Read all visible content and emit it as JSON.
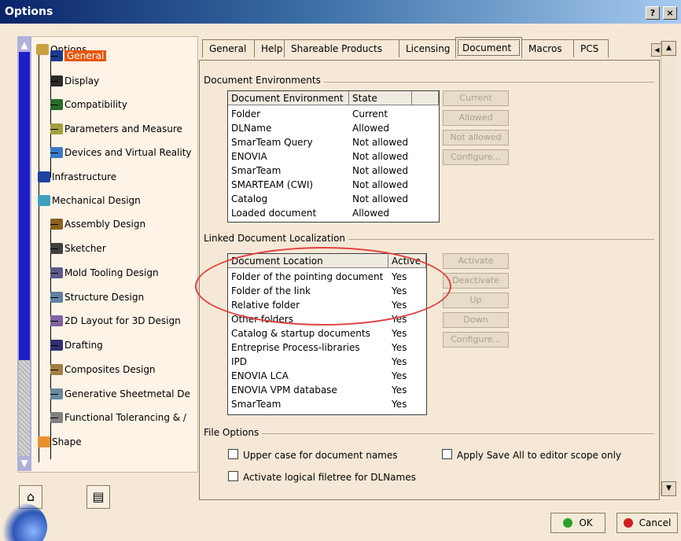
{
  "window": {
    "title": "Options",
    "help_btn": "?",
    "close_btn": "×"
  },
  "tree": {
    "items": [
      {
        "label": "Options",
        "icon": "options-icon"
      },
      {
        "label": "General",
        "icon": "general-icon",
        "selected": true
      },
      {
        "label": "Display",
        "icon": "display-icon"
      },
      {
        "label": "Compatibility",
        "icon": "compatibility-icon"
      },
      {
        "label": "Parameters and Measure",
        "icon": "parameters-icon"
      },
      {
        "label": "Devices and Virtual Reality",
        "icon": "devices-icon"
      },
      {
        "label": "Infrastructure",
        "icon": "infrastructure-icon"
      },
      {
        "label": "Mechanical Design",
        "icon": "mechanical-icon"
      },
      {
        "label": "Assembly Design",
        "icon": "assembly-icon"
      },
      {
        "label": "Sketcher",
        "icon": "sketcher-icon"
      },
      {
        "label": "Mold Tooling Design",
        "icon": "mold-icon"
      },
      {
        "label": "Structure Design",
        "icon": "structure-icon"
      },
      {
        "label": "2D Layout for 3D Design",
        "icon": "layout-icon"
      },
      {
        "label": "Drafting",
        "icon": "drafting-icon"
      },
      {
        "label": "Composites Design",
        "icon": "composites-icon"
      },
      {
        "label": "Generative Sheetmetal De",
        "icon": "sheetmetal-icon"
      },
      {
        "label": "Functional Tolerancing & /",
        "icon": "tolerancing-icon"
      },
      {
        "label": "Shape",
        "icon": "shape-icon"
      }
    ]
  },
  "tabs": [
    "General",
    "Help",
    "Shareable Products",
    "Licensing",
    "Document",
    "Macros",
    "PCS"
  ],
  "active_tab": "Document",
  "doc_env": {
    "group_label": "Document Environments",
    "headers": [
      "Document Environment",
      "State"
    ],
    "rows": [
      [
        "Folder",
        "Current"
      ],
      [
        "DLName",
        "Allowed"
      ],
      [
        "SmarTeam Query",
        "Not allowed"
      ],
      [
        "ENOVIA",
        "Not allowed"
      ],
      [
        "SmarTeam",
        "Not allowed"
      ],
      [
        "SMARTEAM (CWI)",
        "Not allowed"
      ],
      [
        "Catalog",
        "Not allowed"
      ],
      [
        "Loaded document",
        "Allowed"
      ]
    ],
    "buttons": [
      "Current",
      "Allowed",
      "Not allowed",
      "Configure..."
    ]
  },
  "linked_doc": {
    "group_label": "Linked Document Localization",
    "headers": [
      "Document Location",
      "Active"
    ],
    "rows": [
      [
        "Folder of the pointing document",
        "Yes"
      ],
      [
        "Folder of the link",
        "Yes"
      ],
      [
        "Relative folder",
        "Yes"
      ],
      [
        "Other folders",
        "Yes"
      ],
      [
        "Catalog & startup documents",
        "Yes"
      ],
      [
        "Entreprise Process-libraries",
        "Yes"
      ],
      [
        "IPD",
        "Yes"
      ],
      [
        "ENOVIA LCA",
        "Yes"
      ],
      [
        "ENOVIA VPM  database",
        "Yes"
      ],
      [
        "SmarTeam",
        "Yes"
      ]
    ],
    "buttons": [
      "Activate",
      "Deactivate",
      "Up",
      "Down",
      "Configure..."
    ]
  },
  "file_options": {
    "group_label": "File Options",
    "upper_case": "Upper case for document names",
    "apply_save": "Apply Save All to editor scope only",
    "logical_filetree": "Activate logical filetree for DLNames"
  },
  "dialog": {
    "ok": "OK",
    "cancel": "Cancel"
  },
  "colors": {
    "selection": "#e8560a",
    "title_start": "#0a246a",
    "annotation": "#e04040",
    "ok_dot": "#2aa02a",
    "cancel_dot": "#d02020"
  }
}
